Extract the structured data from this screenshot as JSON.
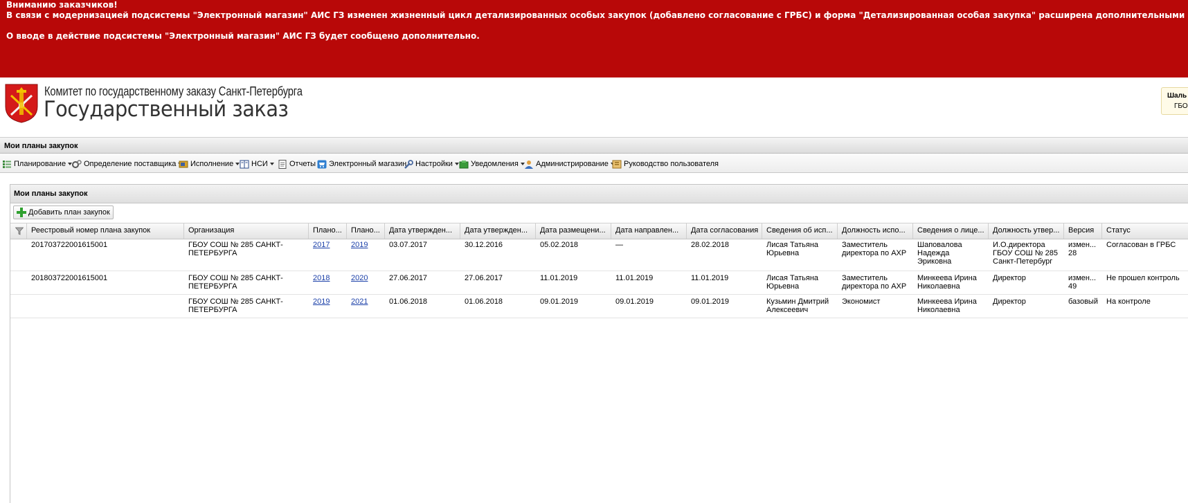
{
  "banner": {
    "line1": "Вниманию заказчиков!",
    "line2": "В связи с модернизацией подсистемы \"Электронный магазин\" АИС ГЗ изменен жизненный цикл детализированных особых закупок (добавлено согласование с ГРБС) и форма \"Детализированная особая закупка\" расширена дополнительными",
    "line3": "О вводе в действие подсистемы \"Электронный магазин\" АИС ГЗ будет сообщено дополнительно."
  },
  "header": {
    "subtitle": "Комитет по государственному заказу Санкт-Петербурга",
    "title": "Государственный заказ",
    "user_name": "Шаль",
    "user_org": "ГБО"
  },
  "page_title": "Мои планы закупок",
  "menu": [
    {
      "label": "Планирование",
      "icon": "planning-icon",
      "dropdown": true
    },
    {
      "label": "Определение поставщика",
      "icon": "gears-icon",
      "dropdown": true
    },
    {
      "label": "Исполнение",
      "icon": "execution-icon",
      "dropdown": true
    },
    {
      "label": "НСИ",
      "icon": "book-icon",
      "dropdown": true
    },
    {
      "label": "Отчеты",
      "icon": "report-icon",
      "dropdown": false
    },
    {
      "label": "Электронный магазин",
      "icon": "cart-icon",
      "dropdown": false
    },
    {
      "label": "Настройки",
      "icon": "wrench-icon",
      "dropdown": true
    },
    {
      "label": "Уведомления",
      "icon": "notification-icon",
      "dropdown": true
    },
    {
      "label": "Администрирование",
      "icon": "user-icon",
      "dropdown": true
    },
    {
      "label": "Руководство пользователя",
      "icon": "manual-icon",
      "dropdown": false
    }
  ],
  "panel": {
    "title": "Мои планы закупок",
    "add_button": "Добавить план закупок"
  },
  "table": {
    "columns": [
      "Реестровый номер плана закупок",
      "Организация",
      "Плано...",
      "Плано...",
      "Дата утвержден...",
      "Дата утвержден...",
      "Дата размещени...",
      "Дата направлен...",
      "Дата согласования",
      "Сведения об исп...",
      "Должность испо...",
      "Сведения о лице...",
      "Должность утвер...",
      "Версия",
      "Статус"
    ],
    "rows": [
      [
        "201703722001615001",
        "ГБОУ СОШ № 285 САНКТ-ПЕТЕРБУРГА",
        "2017",
        "2019",
        "03.07.2017",
        "30.12.2016",
        "05.02.2018",
        "—",
        "28.02.2018",
        "Лисая Татьяна Юрьевна",
        "Заместитель директора по АХР",
        "Шаповалова Надежда Эриковна",
        "И.О.директора ГБОУ СОШ № 285 Санкт-Петербург",
        "измен... 28",
        "Согласован в ГРБС"
      ],
      [
        "201803722001615001",
        "ГБОУ СОШ № 285 САНКТ-ПЕТЕРБУРГА",
        "2018",
        "2020",
        "27.06.2017",
        "27.06.2017",
        "11.01.2019",
        "11.01.2019",
        "11.01.2019",
        "Лисая Татьяна Юрьевна",
        "Заместитель директора по АХР",
        "Минкеева Ирина Николаевна",
        "Директор",
        "измен... 49",
        "Не прошел контроль"
      ],
      [
        "",
        "ГБОУ СОШ № 285 САНКТ-ПЕТЕРБУРГА",
        "2019",
        "2021",
        "01.06.2018",
        "01.06.2018",
        "09.01.2019",
        "09.01.2019",
        "09.01.2019",
        "Кузьмин Дмитрий Алексеевич",
        "Экономист",
        "Минкеева Ирина Николаевна",
        "Директор",
        "базовый",
        "На контроле"
      ]
    ]
  },
  "colors": {
    "banner_bg": "#b80808",
    "link": "#1a3fa8"
  }
}
